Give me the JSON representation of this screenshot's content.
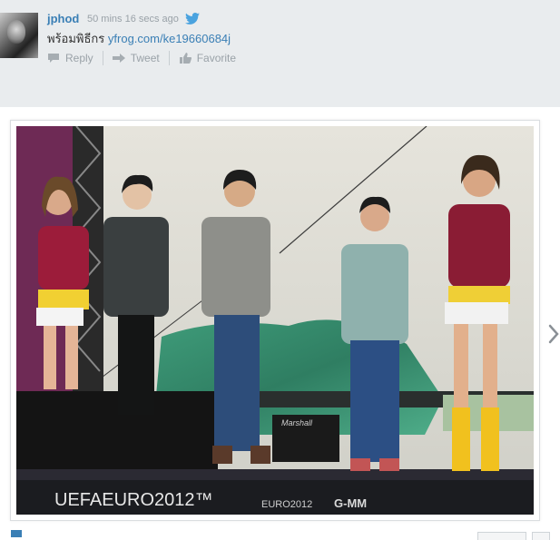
{
  "tweet": {
    "username": "jphod",
    "timestamp": "50 mins 16 secs ago",
    "text_prefix": "พร้อมพิธีกร ",
    "link_text": "yfrog.com/ke19660684j",
    "actions": {
      "reply": "Reply",
      "retweet": "Tweet",
      "favorite": "Favorite"
    }
  },
  "photo": {
    "banner_text": "UEFAEURO2012™",
    "banner_logo2": "EURO2012",
    "sponsor": "G-MM",
    "amp_brand": "Marshall"
  },
  "icons": {
    "bird": "twitter-bird-icon",
    "reply": "reply-icon",
    "retweet": "retweet-icon",
    "favorite": "thumbs-up-icon",
    "next": "chevron-right-icon"
  }
}
